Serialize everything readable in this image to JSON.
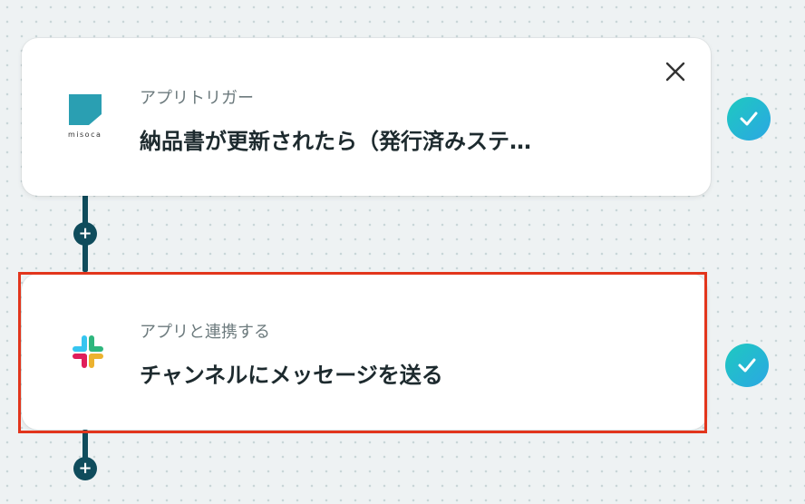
{
  "trigger_card": {
    "type_label": "アプリトリガー",
    "title": "納品書が更新されたら（発行済みステ…",
    "app_name": "misoca"
  },
  "action_card": {
    "type_label": "アプリと連携する",
    "title": "チャンネルにメッセージを送る",
    "app_name": "slack"
  },
  "colors": {
    "accent": "#0f4c5c",
    "selected_border": "#e2351c",
    "check_gradient_start": "#1ec9c0",
    "check_gradient_end": "#2ba7e3"
  },
  "icons": [
    "misoca-logo-icon",
    "close-icon",
    "check-icon",
    "plus-icon",
    "slack-logo-icon"
  ]
}
